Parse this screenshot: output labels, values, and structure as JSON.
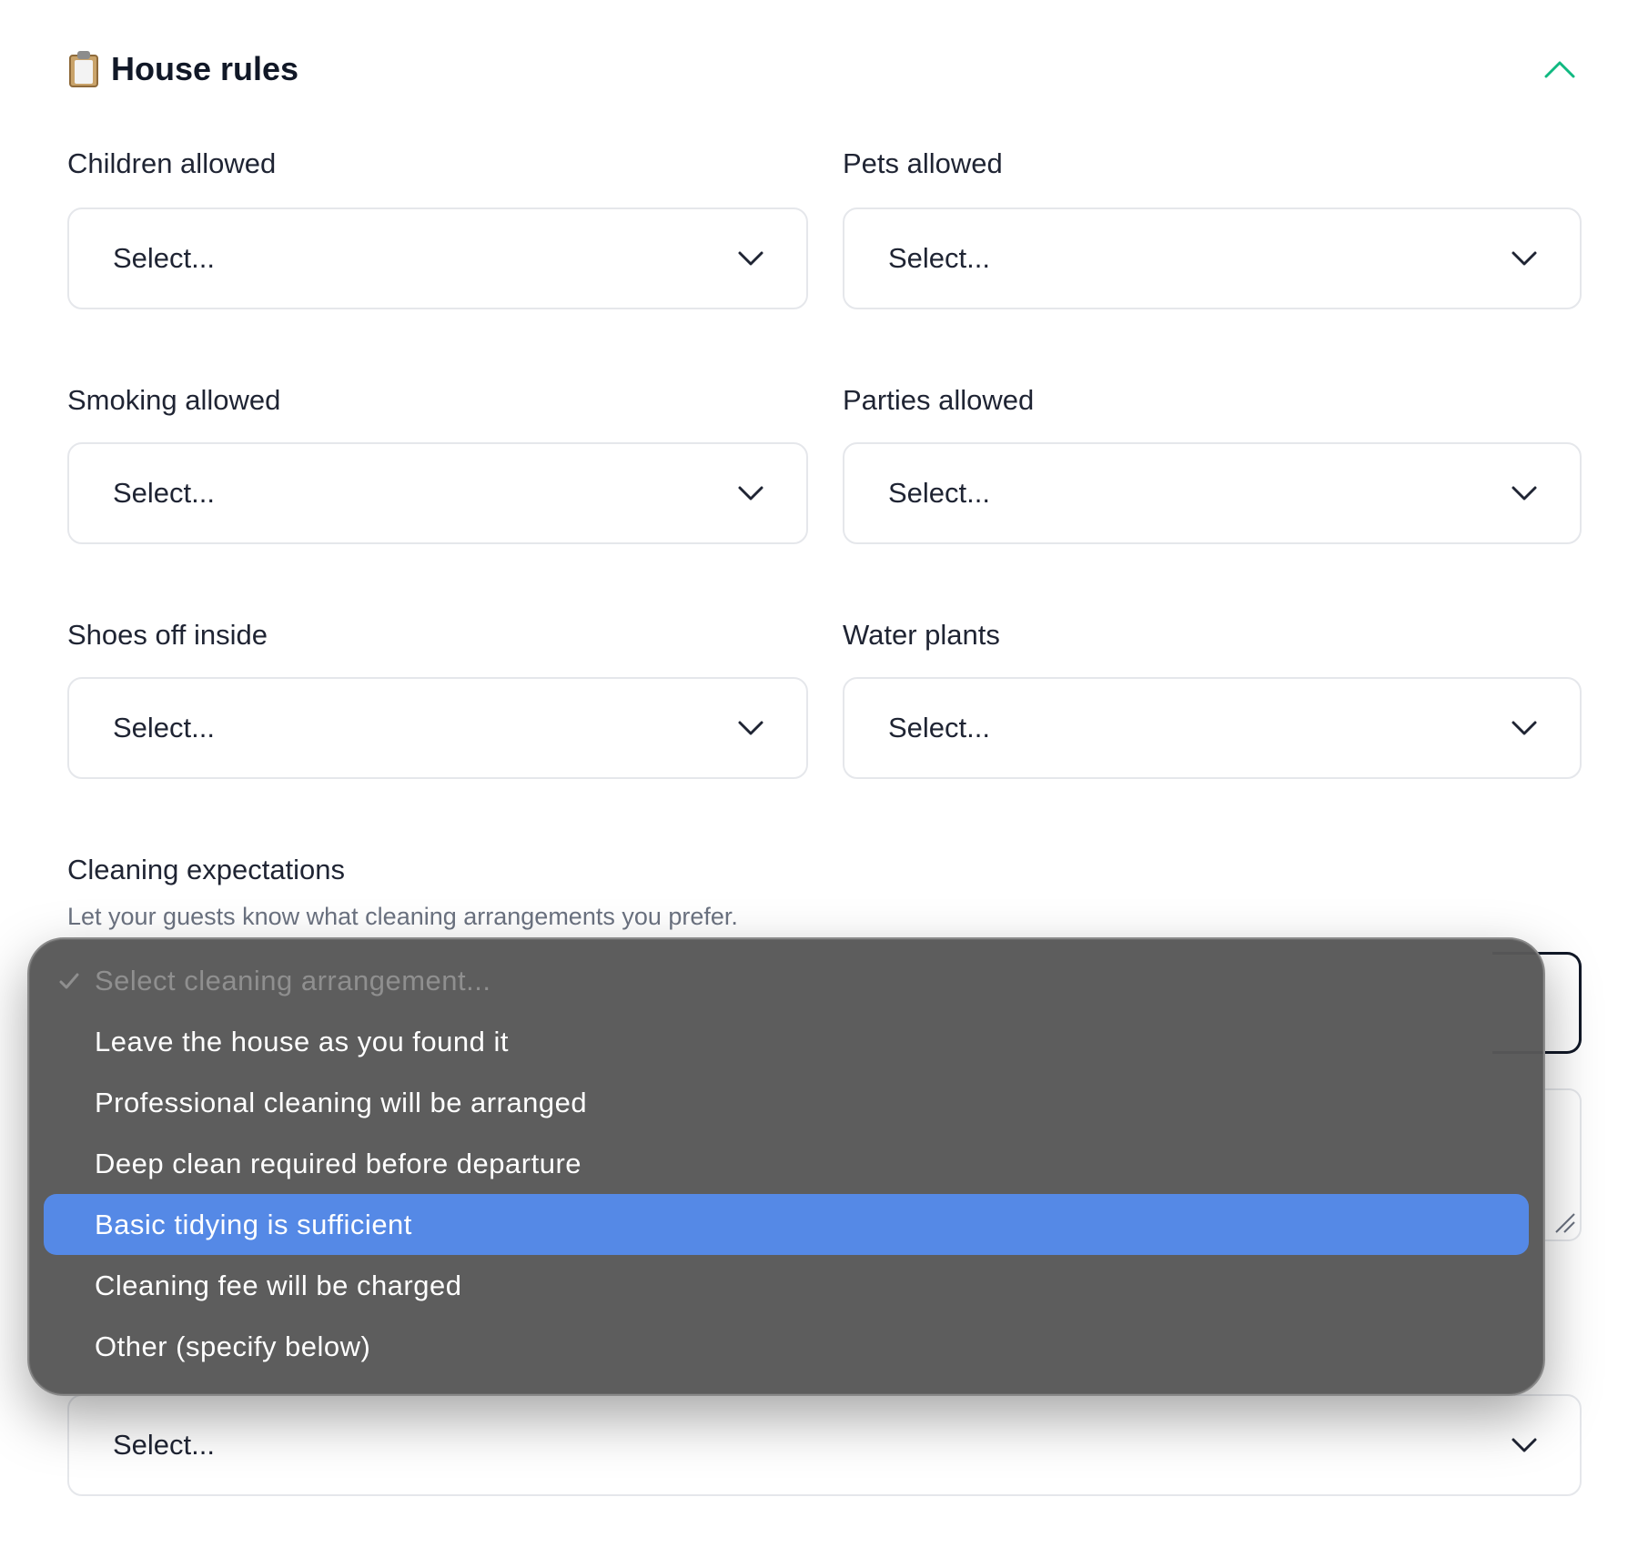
{
  "section": {
    "title": "House rules",
    "icon": "clipboard-icon",
    "collapse_icon": "chevron-up-icon",
    "accent_color": "#10b981"
  },
  "fields": [
    {
      "label": "Children allowed",
      "value": "Select..."
    },
    {
      "label": "Pets allowed",
      "value": "Select..."
    },
    {
      "label": "Smoking allowed",
      "value": "Select..."
    },
    {
      "label": "Parties allowed",
      "value": "Select..."
    },
    {
      "label": "Shoes off inside",
      "value": "Select..."
    },
    {
      "label": "Water plants",
      "value": "Select..."
    }
  ],
  "cleaning": {
    "label": "Cleaning expectations",
    "help": "Let your guests know what cleaning arrangements you prefer.",
    "dropdown": {
      "options": [
        {
          "label": "Select cleaning arrangement...",
          "checked": true,
          "placeholder": true
        },
        {
          "label": "Leave the house as you found it"
        },
        {
          "label": "Professional cleaning will be arranged"
        },
        {
          "label": "Deep clean required before departure"
        },
        {
          "label": "Basic tidying is sufficient",
          "highlighted": true
        },
        {
          "label": "Cleaning fee will be charged"
        },
        {
          "label": "Other (specify below)"
        }
      ],
      "highlight_color": "#5589e6"
    }
  },
  "bottom_select": {
    "value": "Select..."
  }
}
